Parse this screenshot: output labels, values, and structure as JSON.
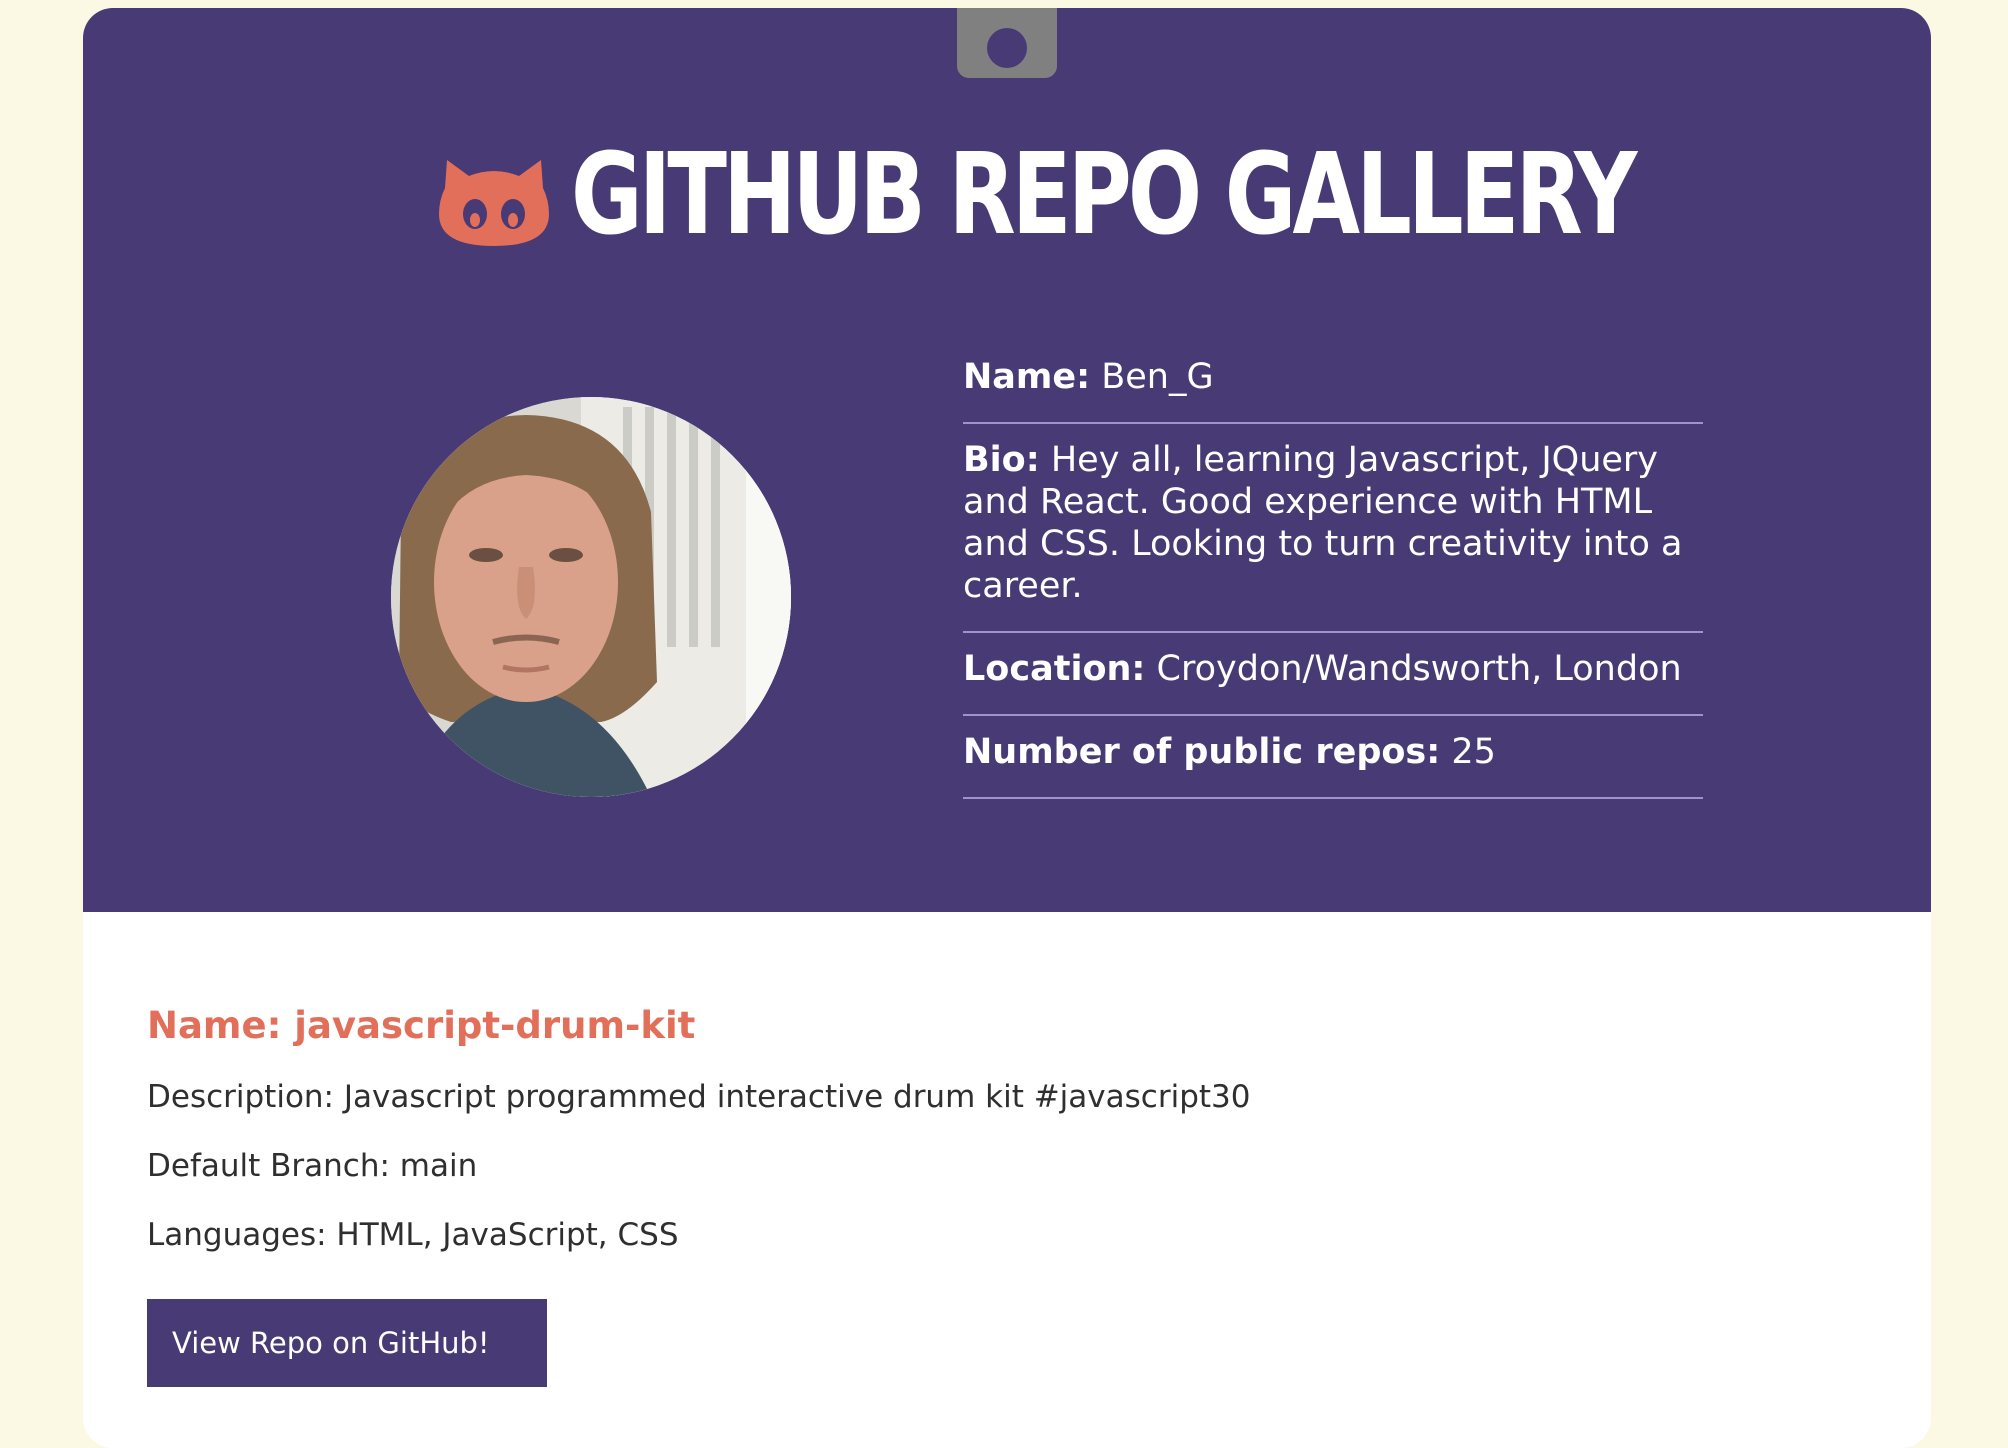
{
  "header": {
    "title": "GITHUB REPO GALLERY"
  },
  "profile": {
    "name_label": "Name:",
    "name_value": "Ben_G",
    "bio_label": "Bio:",
    "bio_value": "Hey all, learning Javascript, JQuery and React. Good experience with HTML and CSS. Looking to turn creativity into a career.",
    "location_label": "Location:",
    "location_value": "Croydon/Wandsworth, London",
    "repos_label": "Number of public repos:",
    "repos_value": "25"
  },
  "repo": {
    "name": "Name: javascript-drum-kit",
    "description": "Description: Javascript programmed interactive drum kit #javascript30",
    "branch": "Default Branch: main",
    "languages": "Languages: HTML, JavaScript, CSS",
    "button_label": "View Repo on GitHub!"
  },
  "colors": {
    "page_background": "#fbf8e4",
    "hero_background": "#473a75",
    "accent": "#e26f5a",
    "divider": "#9e93cb",
    "tab": "#808080"
  },
  "icons": {
    "logo": "octocat-logo-icon"
  }
}
